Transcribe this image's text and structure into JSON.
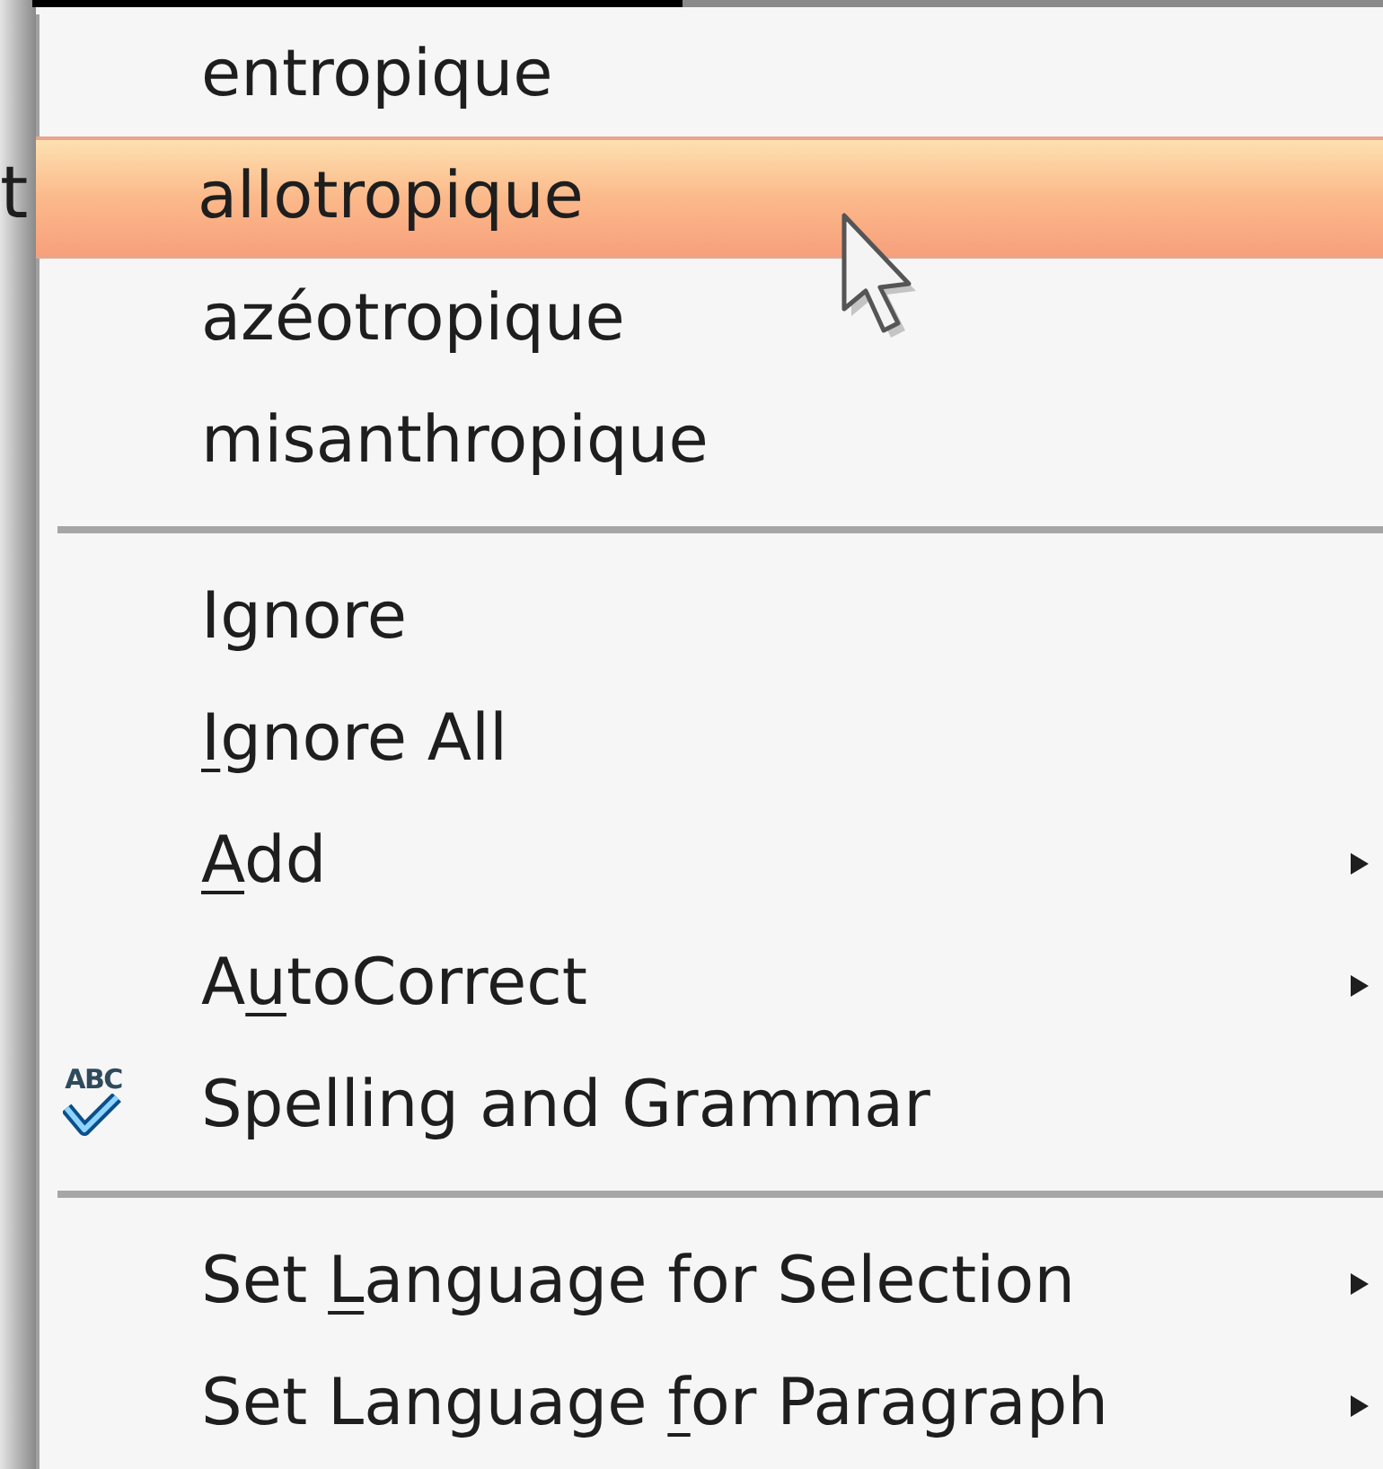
{
  "document_fragment": "t",
  "menu": {
    "sections": [
      {
        "items": [
          {
            "kind": "suggestion",
            "before": "entropique",
            "selected": false
          },
          {
            "kind": "suggestion",
            "before": "allotropique",
            "selected": true
          },
          {
            "kind": "suggestion",
            "before": "azéotropique",
            "selected": false
          },
          {
            "kind": "suggestion",
            "before": "misanthropique",
            "selected": false
          }
        ]
      },
      {
        "items": [
          {
            "kind": "command",
            "before": "Ignore",
            "selected": false
          },
          {
            "kind": "command",
            "key": "I",
            "after": "gnore All",
            "selected": false
          },
          {
            "kind": "command",
            "key": "A",
            "after": "dd",
            "selected": false,
            "submenu": true
          },
          {
            "kind": "command",
            "before": "A",
            "key": "u",
            "after": "toCorrect",
            "selected": false,
            "submenu": true
          },
          {
            "kind": "spelling",
            "icon_text": "ABC",
            "before": "Spelling and Grammar",
            "selected": false
          }
        ]
      },
      {
        "items": [
          {
            "kind": "command",
            "before": "Set ",
            "key": "L",
            "after": "anguage for Selection",
            "selected": false,
            "submenu": true
          },
          {
            "kind": "command",
            "before": "Set Language ",
            "key": "f",
            "after": "or Paragraph",
            "selected": false,
            "submenu": true
          }
        ]
      }
    ]
  }
}
